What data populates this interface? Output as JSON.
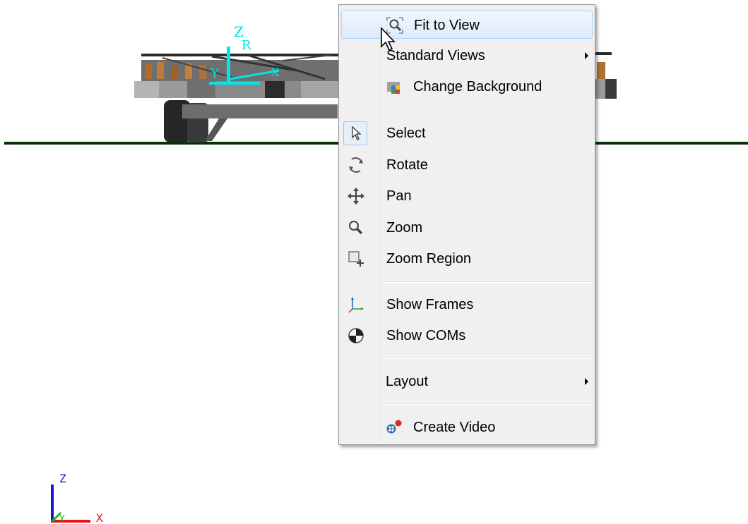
{
  "menu": {
    "fit_to_view": "Fit to View",
    "standard_views": "Standard Views",
    "change_background": "Change Background",
    "select": "Select",
    "rotate": "Rotate",
    "pan": "Pan",
    "zoom": "Zoom",
    "zoom_region": "Zoom Region",
    "show_frames": "Show Frames",
    "show_coms": "Show COMs",
    "layout": "Layout",
    "create_video": "Create Video"
  },
  "model_frame": {
    "z": "Z",
    "r": "R",
    "y": "Y",
    "x": "X"
  },
  "triad": {
    "z": "Z",
    "y": "Y",
    "x": "X"
  },
  "colors": {
    "ground": "#063006",
    "frame": "#00e5e5",
    "menu_bg": "#f0f0f0",
    "highlight_border": "#a8d8f8",
    "triad_z": "#1515d0",
    "triad_x": "#e01515",
    "triad_y": "#18c018"
  },
  "icons": {
    "fit_to_view": "magnifier-fit-icon",
    "standard_views": "none",
    "change_background": "background-icon",
    "select": "cursor-arrow-icon",
    "rotate": "rotate-icon",
    "pan": "pan-icon",
    "zoom": "magnifier-icon",
    "zoom_region": "zoom-region-icon",
    "show_frames": "frame-axes-icon",
    "show_coms": "com-icon",
    "layout": "none",
    "create_video": "video-camera-icon"
  }
}
